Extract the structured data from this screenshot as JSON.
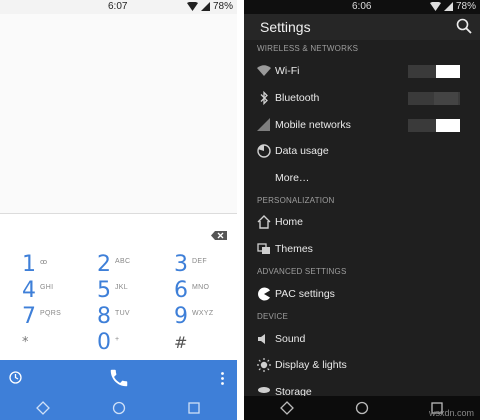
{
  "dialer": {
    "status": {
      "time": "6:07",
      "battery": "78%"
    },
    "keys": [
      {
        "digit": "1",
        "letters": "ꝏ"
      },
      {
        "digit": "2",
        "letters": "ABC"
      },
      {
        "digit": "3",
        "letters": "DEF"
      },
      {
        "digit": "4",
        "letters": "GHI"
      },
      {
        "digit": "5",
        "letters": "JKL"
      },
      {
        "digit": "6",
        "letters": "MNO"
      },
      {
        "digit": "7",
        "letters": "PQRS"
      },
      {
        "digit": "8",
        "letters": "TUV"
      },
      {
        "digit": "9",
        "letters": "WXYZ"
      },
      {
        "digit": "*",
        "letters": ""
      },
      {
        "digit": "0",
        "letters": "+"
      },
      {
        "digit": "#",
        "letters": ""
      }
    ],
    "colors": {
      "accent": "#3e7fd8"
    }
  },
  "settings": {
    "status": {
      "time": "6:06",
      "battery": "78%"
    },
    "title": "Settings",
    "sections": {
      "wireless": "WIRELESS & NETWORKS",
      "personalization": "PERSONALIZATION",
      "advanced": "ADVANCED SETTINGS",
      "device": "DEVICE"
    },
    "items": {
      "wifi": "Wi-Fi",
      "bluetooth": "Bluetooth",
      "mobile": "Mobile networks",
      "data_usage": "Data usage",
      "more": "More…",
      "home": "Home",
      "themes": "Themes",
      "pac": "PAC settings",
      "sound": "Sound",
      "display": "Display & lights",
      "storage": "Storage"
    },
    "toggles": {
      "wifi": true,
      "bluetooth": false,
      "mobile": true
    }
  },
  "watermark": "wsxdn.com"
}
